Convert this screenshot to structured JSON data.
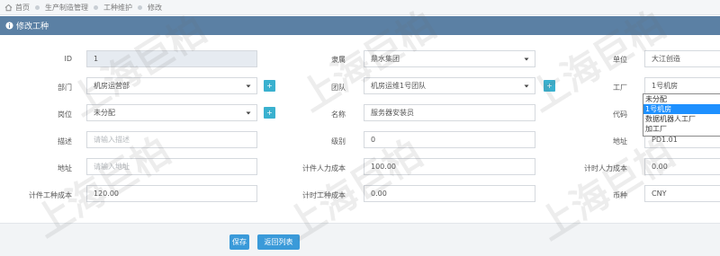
{
  "breadcrumb": {
    "items": [
      "首页",
      "生产制造管理",
      "工种维护",
      "修改"
    ]
  },
  "header": {
    "title": "修改工种"
  },
  "form": {
    "id": {
      "label": "ID",
      "value": "1"
    },
    "belongs": {
      "label": "隶属",
      "value": "鼎水集团"
    },
    "unit": {
      "label": "单位",
      "value": "大江创造"
    },
    "dept": {
      "label": "部门",
      "value": "机房运营部"
    },
    "team": {
      "label": "团队",
      "value": "机房运维1号团队"
    },
    "factory": {
      "label": "工厂",
      "value": "1号机房"
    },
    "post": {
      "label": "岗位",
      "value": "未分配"
    },
    "name": {
      "label": "名称",
      "value": "服务器安装员"
    },
    "code": {
      "label": "代码",
      "value": ""
    },
    "desc": {
      "label": "描述",
      "placeholder": "请输入描述"
    },
    "level": {
      "label": "级别",
      "value": "0"
    },
    "address": {
      "label": "地址",
      "value": "PD1.01"
    },
    "location": {
      "label": "地址",
      "placeholder": "请输入地址"
    },
    "piece_labor_cost": {
      "label": "计件人力成本",
      "value": "100.00"
    },
    "hourly_labor_cost": {
      "label": "计时人力成本",
      "value": "0.00"
    },
    "piece_work_cost": {
      "label": "计件工种成本",
      "value": "120.00"
    },
    "hourly_work_cost": {
      "label": "计时工种成本",
      "value": "0.00"
    },
    "currency": {
      "label": "币种",
      "value": "CNY"
    },
    "add_btn": "+"
  },
  "factory_dropdown": {
    "options": [
      "未分配",
      "1号机房",
      "数据机器人工厂",
      "加工厂"
    ],
    "selected": "1号机房"
  },
  "actions": {
    "save": "保存",
    "back": "返回列表"
  },
  "watermark": {
    "text": "上海巨柏"
  },
  "colors": {
    "header": "#5b80a4",
    "button": "#3a9ad9",
    "square_button": "#3ab1cf",
    "dropdown_selected": "#1e90ff"
  }
}
